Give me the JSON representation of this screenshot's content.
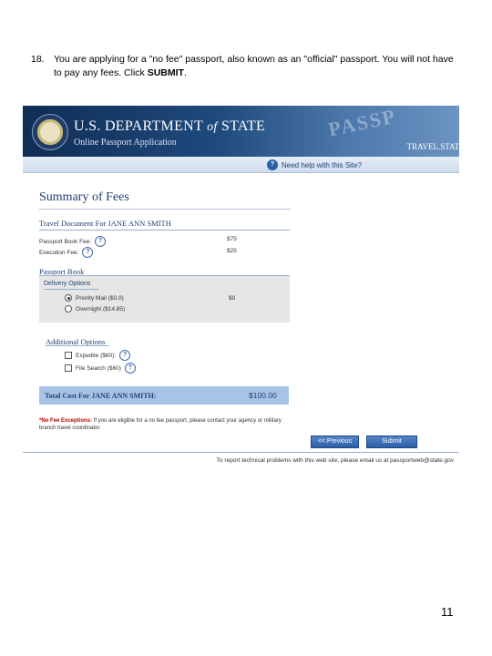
{
  "instruction": {
    "number": "18.",
    "text_prefix": "You are applying for a \"no fee\" passport, also known as an \"official\" passport. You will not have to pay any fees.  Click ",
    "text_bold": "SUBMIT",
    "text_suffix": "."
  },
  "header": {
    "dept_prefix": "U.S. DEPARTMENT ",
    "dept_of": "of",
    "dept_suffix": " STATE",
    "app_name": "Online Passport Application",
    "watermark": "PASSP",
    "travel": "TRAVEL.STAT"
  },
  "helpbar": {
    "link": "Need help with this Site?"
  },
  "summary": {
    "title": "Summary of Fees",
    "travel_doc_heading": "Travel Document For JANE ANN SMITH",
    "passport_book_fee_label": "Passport Book Fee:",
    "passport_book_fee_value": "$75",
    "execution_fee_label": "Execution Fee:",
    "execution_fee_value": "$25",
    "passport_book_heading": "Passport Book",
    "delivery_options_heading": "Delivery Options",
    "delivery_priority_label": "Priority Mail ($0.0)",
    "delivery_priority_value": "$0",
    "delivery_overnight_label": "Overnight ($14.85)",
    "additional_options_heading": "Additional Options",
    "expedite_label": "Expedite ($60):",
    "file_search_label": "File Search ($60)",
    "total_label": "Total Cost For JANE ANN SMITH:",
    "total_value": "$100.00",
    "note_bold": "*No Fee Exceptions:",
    "note_text": " If you are eligible for a no fee passport, please contact your agency or military branch travel coordinator."
  },
  "buttons": {
    "previous": "<< Previous",
    "submit": "Submit"
  },
  "footer": {
    "text": "To report technical problems with this web site, please email us at passportweb@state.gov"
  },
  "page_number": "11",
  "colors": {
    "banner": "#1f4a7e",
    "total_bar": "#a7c4e6",
    "button": "#2b5ea6"
  }
}
